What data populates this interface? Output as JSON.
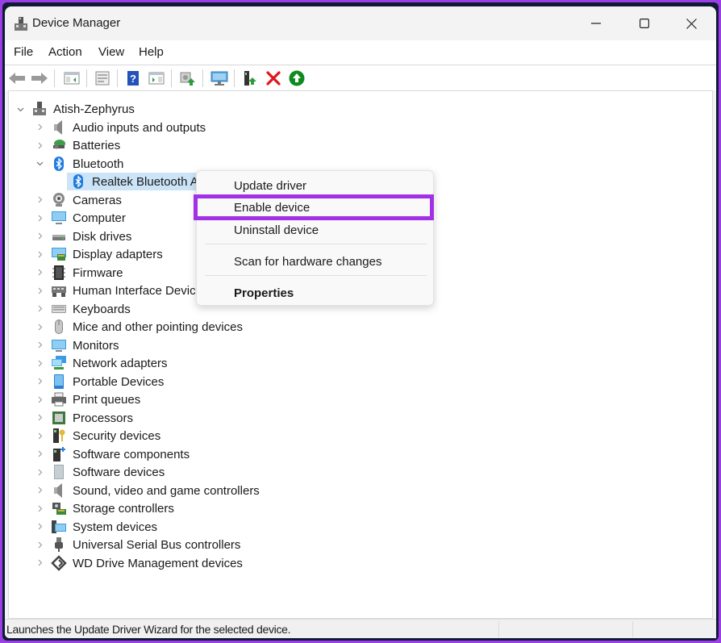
{
  "window": {
    "title": "Device Manager",
    "controls": {
      "minimize": "minimize",
      "maximize": "maximize",
      "close": "close"
    }
  },
  "menubar": {
    "items": [
      "File",
      "Action",
      "View",
      "Help"
    ]
  },
  "toolbar": {
    "buttons": [
      {
        "name": "back",
        "icon": "back-arrow-icon"
      },
      {
        "name": "forward",
        "icon": "forward-arrow-icon"
      },
      {
        "name": "show-hide-console-tree",
        "icon": "console-tree-icon"
      },
      {
        "name": "properties",
        "icon": "properties-icon"
      },
      {
        "name": "help",
        "icon": "help-icon"
      },
      {
        "name": "show-hide-action-pane",
        "icon": "action-pane-icon"
      },
      {
        "name": "update-driver",
        "icon": "update-driver-icon"
      },
      {
        "name": "scan-hardware",
        "icon": "scan-hardware-icon"
      },
      {
        "name": "add-legacy-hardware",
        "icon": "add-hardware-icon"
      },
      {
        "name": "uninstall-device",
        "icon": "uninstall-x-icon"
      },
      {
        "name": "enable-device",
        "icon": "enable-arrow-icon"
      }
    ]
  },
  "tree": {
    "root": "Atish-Zephyrus",
    "categories": [
      {
        "label": "Audio inputs and outputs",
        "icon": "speaker-icon",
        "expanded": false
      },
      {
        "label": "Batteries",
        "icon": "battery-icon",
        "expanded": false
      },
      {
        "label": "Bluetooth",
        "icon": "bluetooth-icon",
        "expanded": true,
        "children": [
          "Realtek Bluetooth Adapter"
        ]
      },
      {
        "label": "Cameras",
        "icon": "camera-icon",
        "expanded": false
      },
      {
        "label": "Computer",
        "icon": "computer-icon",
        "expanded": false
      },
      {
        "label": "Disk drives",
        "icon": "disk-drive-icon",
        "expanded": false
      },
      {
        "label": "Display adapters",
        "icon": "display-adapter-icon",
        "expanded": false
      },
      {
        "label": "Firmware",
        "icon": "firmware-chip-icon",
        "expanded": false
      },
      {
        "label": "Human Interface Devices",
        "icon": "hid-icon",
        "expanded": false
      },
      {
        "label": "Keyboards",
        "icon": "keyboard-icon",
        "expanded": false
      },
      {
        "label": "Mice and other pointing devices",
        "icon": "mouse-icon",
        "expanded": false
      },
      {
        "label": "Monitors",
        "icon": "monitor-icon",
        "expanded": false
      },
      {
        "label": "Network adapters",
        "icon": "network-adapter-icon",
        "expanded": false
      },
      {
        "label": "Portable Devices",
        "icon": "portable-device-icon",
        "expanded": false
      },
      {
        "label": "Print queues",
        "icon": "printer-icon",
        "expanded": false
      },
      {
        "label": "Processors",
        "icon": "processor-icon",
        "expanded": false
      },
      {
        "label": "Security devices",
        "icon": "security-key-icon",
        "expanded": false
      },
      {
        "label": "Software components",
        "icon": "software-component-icon",
        "expanded": false
      },
      {
        "label": "Software devices",
        "icon": "software-device-icon",
        "expanded": false
      },
      {
        "label": "Sound, video and game controllers",
        "icon": "speaker-icon",
        "expanded": false
      },
      {
        "label": "Storage controllers",
        "icon": "storage-controller-icon",
        "expanded": false
      },
      {
        "label": "System devices",
        "icon": "system-device-icon",
        "expanded": false
      },
      {
        "label": "Universal Serial Bus controllers",
        "icon": "usb-icon",
        "expanded": false
      },
      {
        "label": "WD Drive Management devices",
        "icon": "wd-drive-icon",
        "expanded": false
      }
    ],
    "selected_child_visible_text": "Realtek Bluetooth Ac"
  },
  "context_menu": {
    "items": [
      {
        "label": "Update driver"
      },
      {
        "label": "Enable device",
        "highlighted": true
      },
      {
        "label": "Uninstall device"
      },
      {
        "label": "Scan for hardware changes"
      },
      {
        "label": "Properties",
        "bold": true
      }
    ]
  },
  "statusbar": {
    "text": "Launches the Update Driver Wizard for the selected device."
  },
  "colors": {
    "frame_accent": "#9a3fe6",
    "highlight_box": "#a230e6",
    "selection": "#cce4f7"
  }
}
